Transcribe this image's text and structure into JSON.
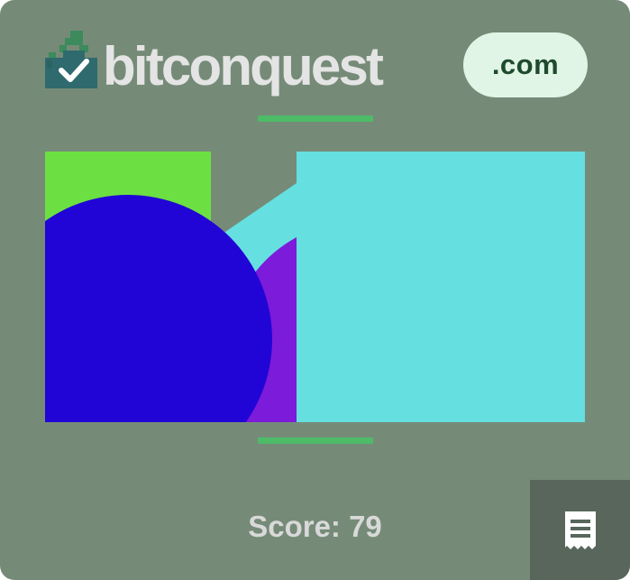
{
  "logo": {
    "icon": "castle-check-icon",
    "wordmark": "bitconquest",
    "tld": ".com"
  },
  "accent_color": "#4dbb68",
  "game": {
    "shapes": [
      {
        "kind": "rect",
        "color": "#6ce042"
      },
      {
        "kind": "polygon",
        "color": "#65dfe0"
      },
      {
        "kind": "circle",
        "color": "#7c1bd9"
      },
      {
        "kind": "circle",
        "color": "#2105d6"
      }
    ]
  },
  "score": {
    "text": "Score: 79"
  },
  "receipt_button": {
    "icon": "receipt-icon"
  }
}
